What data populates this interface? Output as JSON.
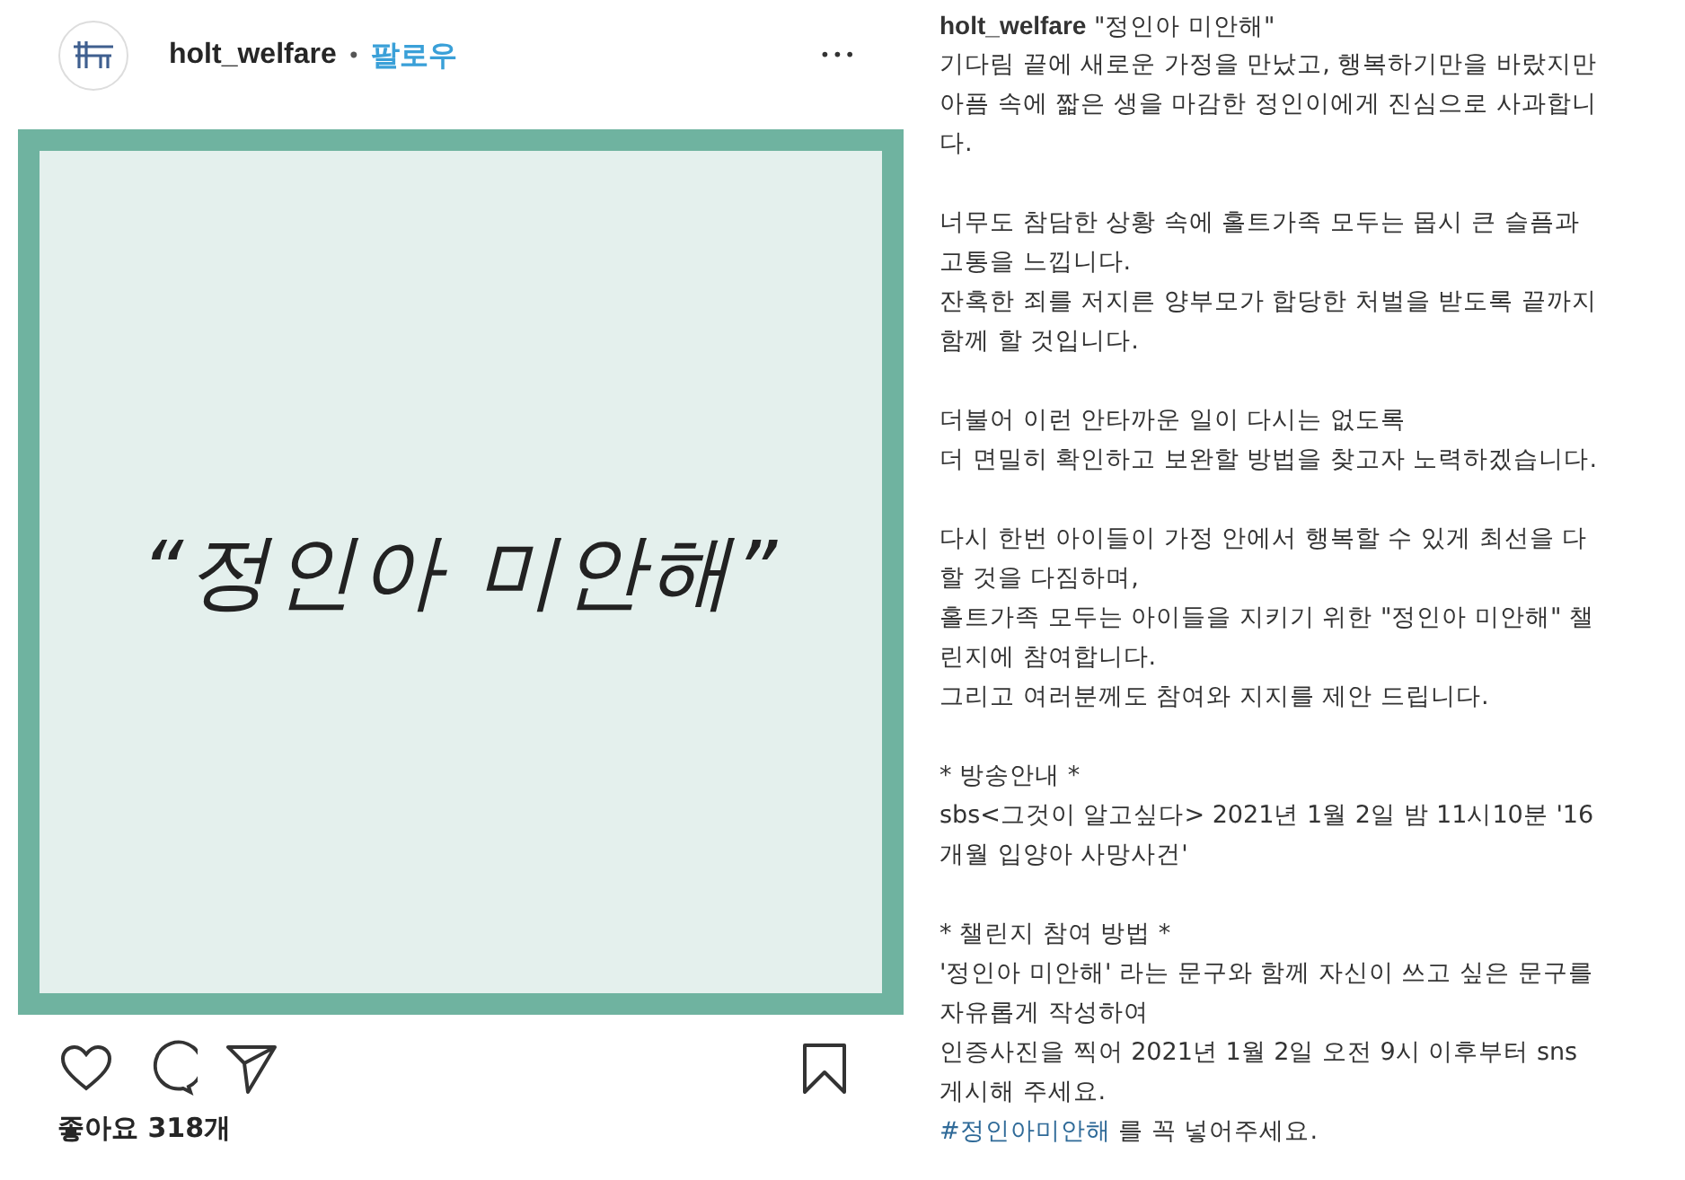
{
  "post": {
    "username": "holt_welfare",
    "separator": "•",
    "follow": "팔로우",
    "more": "•••"
  },
  "image": {
    "text": "“정인아 미안해”"
  },
  "actions": {
    "likes": "좋아요 318개"
  },
  "caption": {
    "username": "holt_welfare",
    "title": "\"정인아 미안해\"",
    "paragraphs": [
      [
        "기다림 끝에 새로운 가정을 만났고, 행복하기만을 바랐지만",
        "아픔 속에 짧은 생을 마감한 정인이에게 진심으로 사과합니",
        "다."
      ],
      [
        "너무도 참담한 상황 속에 홀트가족 모두는 몹시 큰 슬픔과",
        "고통을 느낍니다.",
        "잔혹한 죄를 저지른 양부모가 합당한 처벌을 받도록 끝까지",
        "함께 할 것입니다."
      ],
      [
        "더불어 이런 안타까운 일이 다시는 없도록",
        "더 면밀히 확인하고 보완할 방법을 찾고자 노력하겠습니다."
      ],
      [
        "다시 한번 아이들이 가정 안에서 행복할 수 있게 최선을 다",
        "할 것을 다짐하며,",
        "홀트가족 모두는 아이들을 지키기 위한 \"정인아 미안해\" 챌",
        "린지에 참여합니다.",
        "그리고 여러분께도 참여와 지지를 제안 드립니다."
      ],
      [
        "* 방송안내 *",
        "sbs<그것이 알고싶다> 2021년 1월 2일 밤 11시10분 '16",
        "개월 입양아 사망사건'"
      ],
      [
        "* 챌린지 참여 방법 *",
        "'정인아 미안해' 라는 문구와 함께 자신이 쓰고 싶은 문구를",
        "자유롭게 작성하여",
        "인증사진을 찍어 2021년 1월 2일 오전 9시 이후부터 sns",
        "게시해 주세요."
      ]
    ],
    "hashtag": "#정인아미안해",
    "hashtag_rest": "를 꼭 넣어주세요."
  }
}
